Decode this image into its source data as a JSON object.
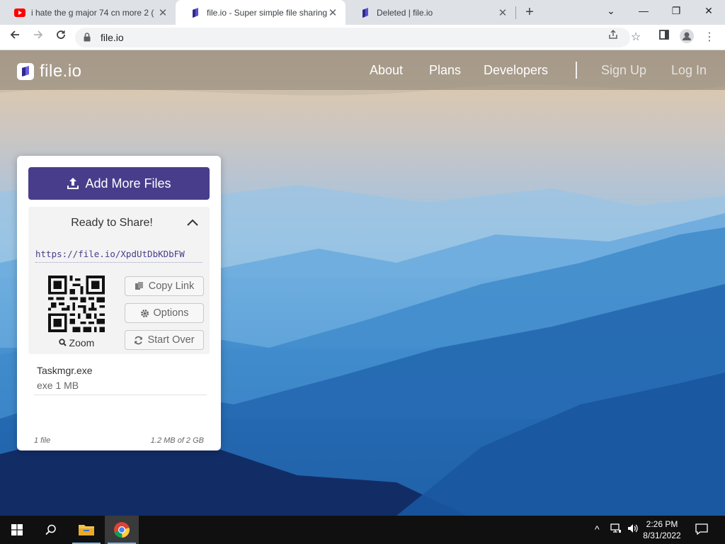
{
  "browser": {
    "tabs": [
      {
        "title": "i hate the g major 74 cn more 2 (",
        "favicon": "youtube-icon",
        "active": false
      },
      {
        "title": "file.io - Super simple file sharing",
        "favicon": "fileio-icon",
        "active": true
      },
      {
        "title": "Deleted | file.io",
        "favicon": "fileio-icon",
        "active": false
      }
    ],
    "url": "file.io"
  },
  "site": {
    "brand": "file.io",
    "nav": {
      "about": "About",
      "plans": "Plans",
      "developers": "Developers",
      "sign_up": "Sign Up",
      "log_in": "Log In"
    }
  },
  "uploader": {
    "add_button": "Add More Files",
    "status": "Ready to Share!",
    "share_link": "https://file.io/XpdUtDbKDbFW",
    "zoom": "Zoom",
    "copy_link": "Copy Link",
    "options": "Options",
    "start_over": "Start Over",
    "file": {
      "name": "Taskmgr.exe",
      "meta": "exe 1 MB"
    },
    "footer": {
      "count": "1 file",
      "usage": "1.2 MB of 2 GB"
    }
  },
  "taskbar": {
    "time": "2:26 PM",
    "date": "8/31/2022"
  },
  "colors": {
    "accent": "#483d8b",
    "tab_strip": "#dee1e6",
    "taskbar": "#101010"
  }
}
